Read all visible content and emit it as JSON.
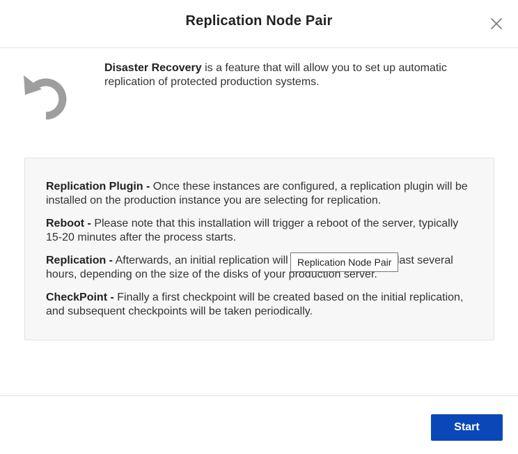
{
  "dialog": {
    "title": "Replication Node Pair",
    "close_icon": "close-icon"
  },
  "intro": {
    "icon": "undo-arrow-icon",
    "icon_color": "#9e9e9e",
    "highlight": "Disaster Recovery",
    "text": " is a feature that will allow you to set up automatic replication of protected production systems."
  },
  "info": {
    "items": [
      {
        "term": "Replication Plugin -",
        "text": " Once these instances are configured, a replication plugin will be installed on the production instance you are selecting for replication."
      },
      {
        "term": "Reboot -",
        "text": " Please note that this installation will trigger a reboot of the server, typically 15-20 minutes after the process starts."
      },
      {
        "term": "Replication -",
        "text": " Afterwards, an initial replication will begin. This step may last several hours, depending on the size of the disks of your production server."
      },
      {
        "term": "CheckPoint -",
        "text": " Finally a first checkpoint will be created based on the initial replication, and subsequent checkpoints will be taken periodically."
      }
    ]
  },
  "tooltip": {
    "text": "Replication Node Pair"
  },
  "footer": {
    "start_label": "Start",
    "start_color": "#0a47b8"
  }
}
